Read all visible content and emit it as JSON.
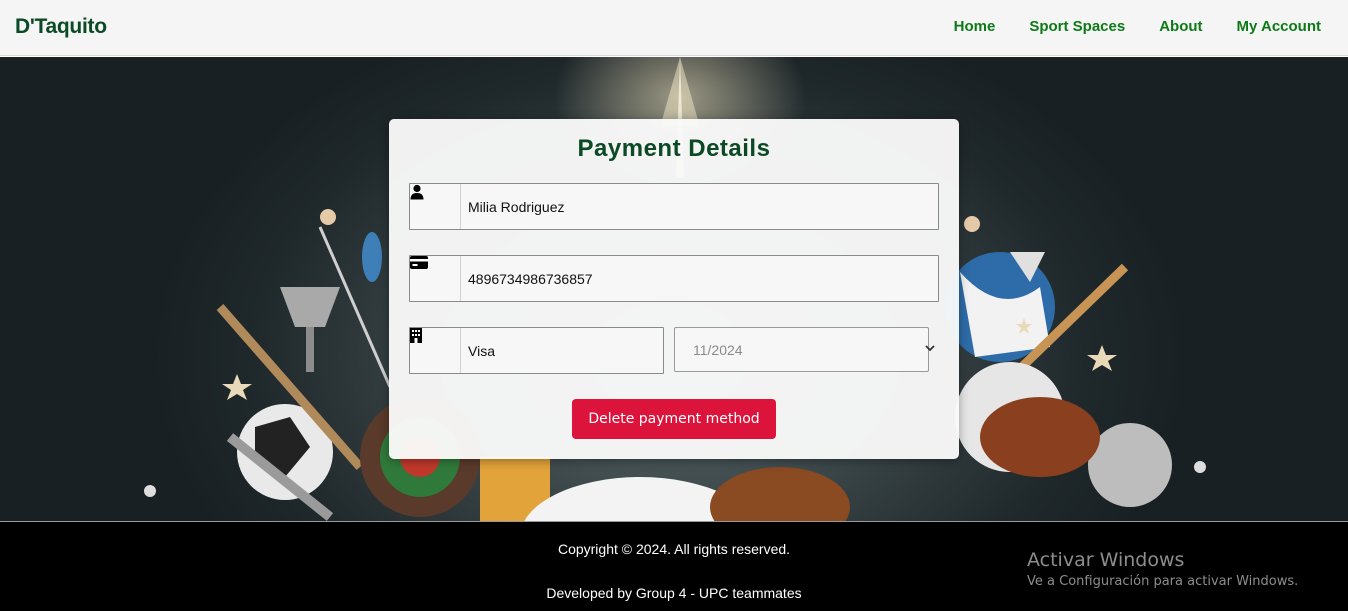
{
  "navbar": {
    "brand": "D'Taquito",
    "links": [
      "Home",
      "Sport Spaces",
      "About",
      "My Account"
    ]
  },
  "payment": {
    "title": "Payment Details",
    "card_holder": "Milia Rodriguez",
    "card_number": "4896734986736857",
    "card_type": "Visa",
    "expiry_selected": "11/2024",
    "delete_label": "Delete payment method"
  },
  "icons": {
    "holder": "user-icon",
    "number": "credit-card-icon",
    "type": "building-icon",
    "expiry": "chevron-down-icon"
  },
  "footer": {
    "copyright": "Copyright © 2024. All rights reserved.",
    "developed": "Developed by Group 4 - UPC teammates"
  },
  "windows_watermark": {
    "title": "Activar Windows",
    "subtitle": "Ve a Configuración para activar Windows."
  },
  "colors": {
    "brand": "#0b4a24",
    "nav_link": "#0c7a16",
    "delete_button": "#dc143c",
    "footer_bg": "#000000"
  }
}
